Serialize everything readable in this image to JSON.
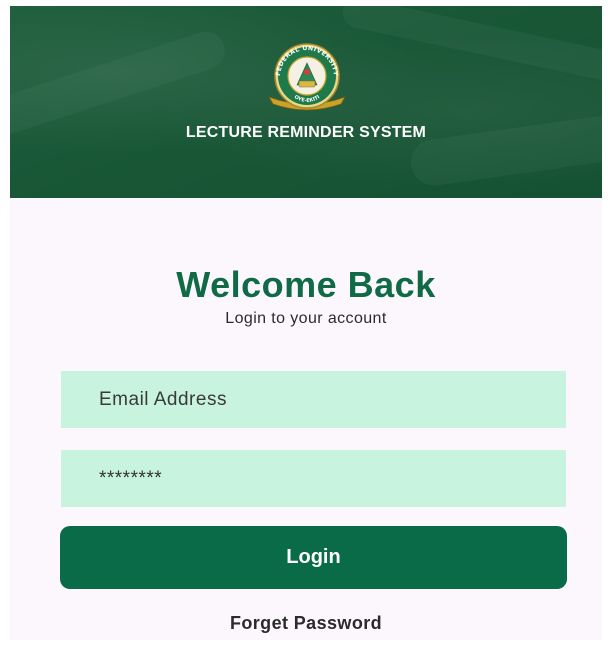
{
  "header": {
    "logo": {
      "icon": "university-crest-icon",
      "top_text": "FEDERAL UNIVERSITY",
      "bottom_text": "OYE-EKITI"
    },
    "title": "LECTURE REMINDER SYSTEM"
  },
  "login": {
    "welcome": "Welcome Back",
    "subtitle": "Login to your account",
    "email_placeholder": "Email Address",
    "password_value": "********",
    "login_label": "Login",
    "forget_label": "Forget Password"
  },
  "colors": {
    "primary": "#0a6b48",
    "field_bg": "#c7f3df",
    "page_bg": "#fcf7fd"
  }
}
